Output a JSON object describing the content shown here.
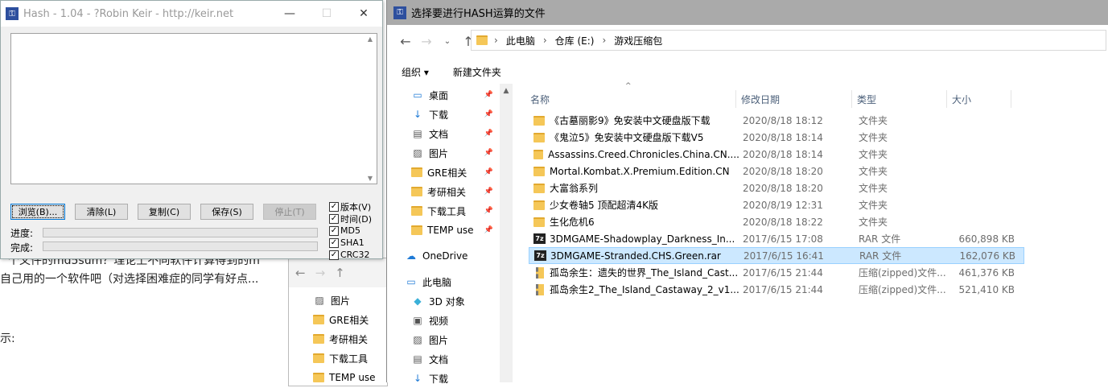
{
  "article": {
    "line1": "个文件的md5sum？理论上不同软件计算得到的m",
    "line2": "自己用的一个软件吧（对选择困难症的同学有好点...",
    "line3": "示:"
  },
  "back_window": {
    "tree": [
      {
        "label": "图片",
        "icon": "pictures-icon"
      },
      {
        "label": "GRE相关",
        "icon": "folder-icon"
      },
      {
        "label": "考研相关",
        "icon": "folder-icon"
      },
      {
        "label": "下载工具",
        "icon": "folder-icon"
      },
      {
        "label": "TEMP use",
        "icon": "folder-icon"
      }
    ]
  },
  "hash": {
    "title": "Hash - 1.04 - ?Robin Keir - http://keir.net",
    "buttons": {
      "browse": "浏览(B)...",
      "clear": "清除(L)",
      "copy": "复制(C)",
      "save": "保存(S)",
      "stop": "停止(T)"
    },
    "progress_label": "进度:",
    "done_label": "完成:",
    "checkboxes": [
      {
        "label": "版本(V)",
        "checked": true
      },
      {
        "label": "时间(D)",
        "checked": true
      },
      {
        "label": "MD5",
        "checked": true
      },
      {
        "label": "SHA1",
        "checked": true
      },
      {
        "label": "CRC32",
        "checked": true
      }
    ]
  },
  "dialog": {
    "title": "选择要进行HASH运算的文件",
    "breadcrumb": [
      "此电脑",
      "仓库 (E:)",
      "游戏压缩包"
    ],
    "toolbar": {
      "organize": "组织 ▾",
      "new_folder": "新建文件夹"
    },
    "nav": [
      {
        "label": "桌面",
        "icon": "desktop-icon",
        "pinned": true
      },
      {
        "label": "下载",
        "icon": "download-icon",
        "pinned": true
      },
      {
        "label": "文档",
        "icon": "documents-icon",
        "pinned": true
      },
      {
        "label": "图片",
        "icon": "pictures-icon",
        "pinned": true
      },
      {
        "label": "GRE相关",
        "icon": "folder-icon",
        "pinned": true
      },
      {
        "label": "考研相关",
        "icon": "folder-icon",
        "pinned": true
      },
      {
        "label": "下载工具",
        "icon": "folder-icon",
        "pinned": true
      },
      {
        "label": "TEMP use",
        "icon": "folder-icon",
        "pinned": true
      },
      {
        "label": "OneDrive",
        "icon": "onedrive-icon",
        "pinned": false
      },
      {
        "label": "此电脑",
        "icon": "this-pc-icon",
        "pinned": false
      },
      {
        "label": "3D 对象",
        "icon": "3d-objects-icon",
        "pinned": false
      },
      {
        "label": "视频",
        "icon": "videos-icon",
        "pinned": false
      },
      {
        "label": "图片",
        "icon": "pictures-icon",
        "pinned": false
      },
      {
        "label": "文档",
        "icon": "documents-icon",
        "pinned": false
      },
      {
        "label": "下载",
        "icon": "download-icon",
        "pinned": false
      }
    ],
    "columns": {
      "name": "名称",
      "date": "修改日期",
      "type": "类型",
      "size": "大小"
    },
    "files": [
      {
        "name": "《古墓丽影9》免安装中文硬盘版下载",
        "date": "2020/8/18 18:12",
        "type": "文件夹",
        "size": "",
        "icon": "folder-icon",
        "selected": false
      },
      {
        "name": "《鬼泣5》免安装中文硬盘版下载V5",
        "date": "2020/8/18 18:14",
        "type": "文件夹",
        "size": "",
        "icon": "folder-icon",
        "selected": false
      },
      {
        "name": "Assassins.Creed.Chronicles.China.CN....",
        "date": "2020/8/18 18:14",
        "type": "文件夹",
        "size": "",
        "icon": "folder-icon",
        "selected": false
      },
      {
        "name": "Mortal.Kombat.X.Premium.Edition.CN",
        "date": "2020/8/18 18:20",
        "type": "文件夹",
        "size": "",
        "icon": "folder-icon",
        "selected": false
      },
      {
        "name": "大富翁系列",
        "date": "2020/8/18 18:20",
        "type": "文件夹",
        "size": "",
        "icon": "folder-icon",
        "selected": false
      },
      {
        "name": "少女卷轴5 顶配超清4K版",
        "date": "2020/8/19 12:31",
        "type": "文件夹",
        "size": "",
        "icon": "folder-icon",
        "selected": false
      },
      {
        "name": "生化危机6",
        "date": "2020/8/18 18:22",
        "type": "文件夹",
        "size": "",
        "icon": "folder-icon",
        "selected": false
      },
      {
        "name": "3DMGAME-Shadowplay_Darkness_In...",
        "date": "2017/6/15 17:08",
        "type": "RAR 文件",
        "size": "660,898 KB",
        "icon": "rar-icon",
        "selected": false
      },
      {
        "name": "3DMGAME-Stranded.CHS.Green.rar",
        "date": "2017/6/15 16:41",
        "type": "RAR 文件",
        "size": "162,076 KB",
        "icon": "rar-icon",
        "selected": true
      },
      {
        "name": "孤岛余生：遗失的世界_The_Island_Cast...",
        "date": "2017/6/15 21:44",
        "type": "压缩(zipped)文件...",
        "size": "461,376 KB",
        "icon": "zip-icon",
        "selected": false
      },
      {
        "name": "孤岛余生2_The_Island_Castaway_2_v1...",
        "date": "2017/6/15 21:44",
        "type": "压缩(zipped)文件...",
        "size": "521,410 KB",
        "icon": "zip-icon",
        "selected": false
      }
    ]
  }
}
